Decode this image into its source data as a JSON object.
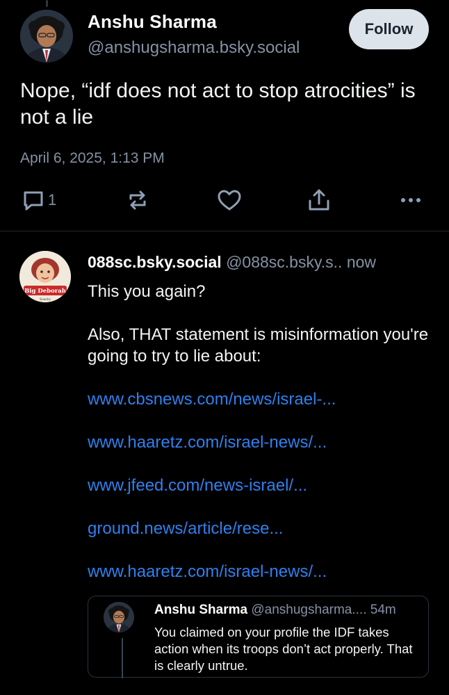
{
  "main_post": {
    "author_name": "Anshu Sharma",
    "author_handle": "@anshugsharma.bsky.social",
    "follow_label": "Follow",
    "text": "Nope, “idf does not act to stop atrocities” is not a lie",
    "timestamp": "April 6, 2025, 1:13 PM",
    "actions": {
      "reply_count": "1",
      "reply_icon": "reply-icon",
      "repost_icon": "repost-icon",
      "like_icon": "heart-icon",
      "share_icon": "share-icon",
      "more_icon": "more-icon"
    },
    "accent_color": "#2f80ed"
  },
  "reply": {
    "author_name": "088sc.bsky.social",
    "author_handle": "@088sc.bsky.s..",
    "time": "now",
    "avatar_text": "Big Deborah",
    "avatar_subtext": "Snacks",
    "paragraphs": [
      "This you again?",
      "Also, THAT statement is misinformation you're going to try to lie about:"
    ],
    "links": [
      "www.cbsnews.com/news/israel-...",
      "www.haaretz.com/israel-news/...",
      "www.jfeed.com/news-israel/...",
      "ground.news/article/rese...",
      "www.haaretz.com/israel-news/..."
    ],
    "link_color": "#2f80ed"
  },
  "quote": {
    "author_name": "Anshu Sharma",
    "author_handle": "@anshugsharma....",
    "time": "54m",
    "text": "You claimed on your profile the IDF takes action when its troops don’t act properly. That is clearly untrue."
  }
}
